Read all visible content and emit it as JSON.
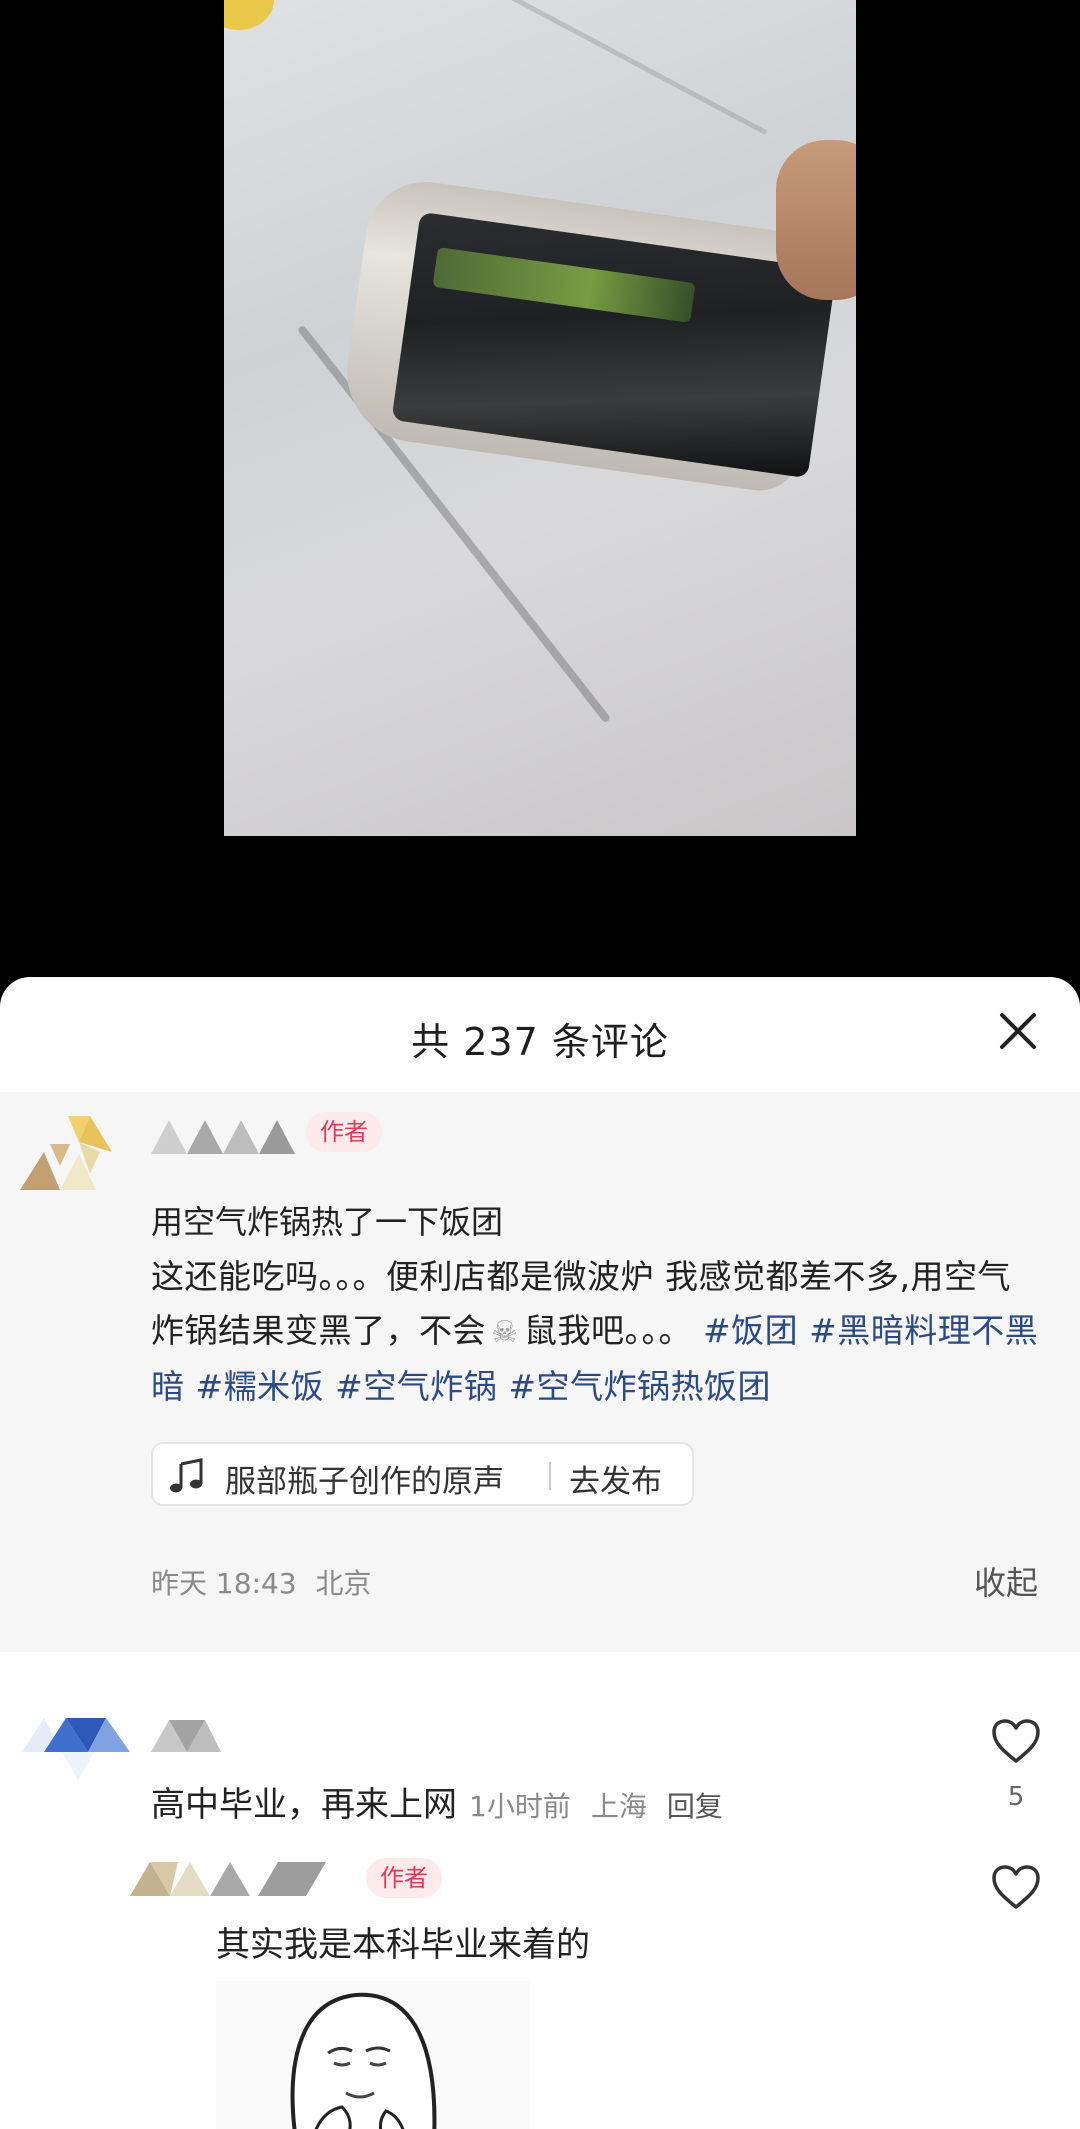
{
  "sheet": {
    "title": "共 237 条评论"
  },
  "post": {
    "author_tag": "作者",
    "title": "用空气炸锅热了一下饭团",
    "body_text_1": "这还能吃吗。。。便利店都是微波炉 我感觉都差不多,用空气炸锅结果变黑了，不会",
    "body_text_2": "鼠我吧。。。",
    "hashtags": [
      "#饭团",
      "#黑暗料理不黑暗",
      "#糯米饭",
      "#空气炸锅",
      "#空气炸锅热饭团"
    ],
    "music_label": "服部瓶子创作的原声",
    "publish_label": "去发布",
    "timestamp": "昨天 18:43",
    "location": "北京",
    "collapse_label": "收起"
  },
  "comments": [
    {
      "text": "高中毕业，再来上网",
      "time": "1小时前",
      "location": "上海",
      "reply_label": "回复",
      "likes": "5"
    },
    {
      "author_tag": "作者",
      "text": "其实我是本科毕业来着的"
    }
  ],
  "colors": {
    "hashtag": "#2b4a86",
    "author_tag_text": "#e23b55",
    "author_tag_bg": "#fdeaec"
  }
}
